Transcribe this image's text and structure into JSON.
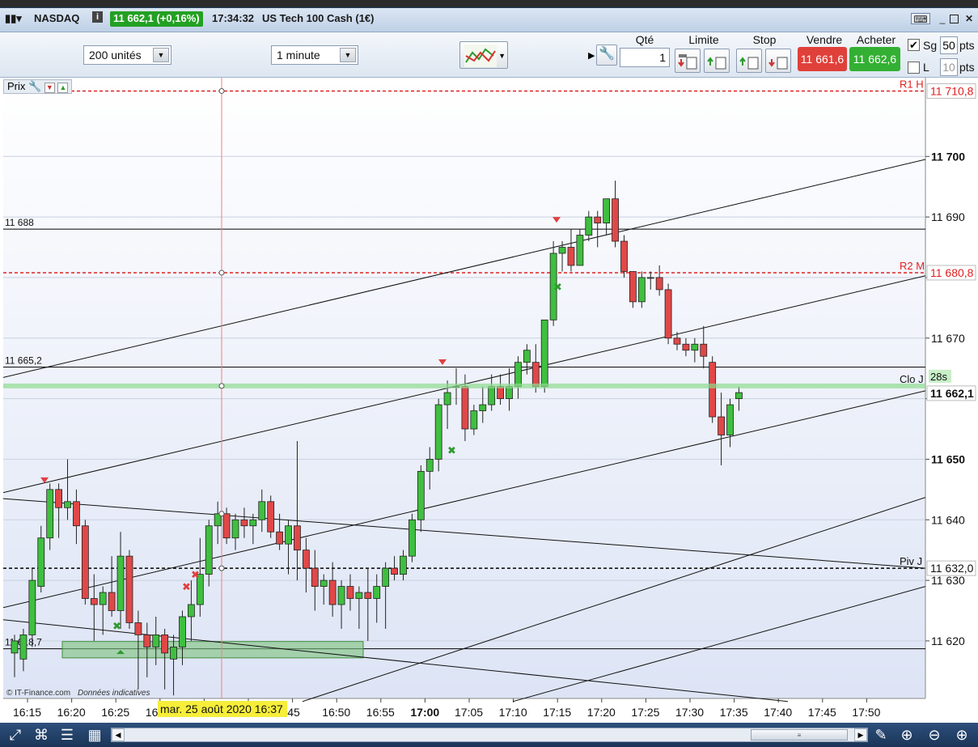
{
  "titlebar": {
    "instrument": "NASDAQ",
    "info_icon": "i",
    "price_change": "11 662,1 (+0,16%)",
    "time": "17:34:32",
    "instrument_full": "US Tech 100 Cash (1€)"
  },
  "toolbar": {
    "units_select": "200 unités",
    "timeframe_select": "1 minute",
    "qty_label": "Qté",
    "qty_value": "1",
    "limit_label": "Limite",
    "stop_label": "Stop",
    "sell_label": "Vendre",
    "buy_label": "Acheter",
    "sell_price": "11 661,6",
    "buy_price": "11 662,6",
    "sg_label": "Sg",
    "sg_value": "50",
    "sg_checked": true,
    "l_label": "L",
    "l_value": "10",
    "pts_label": "pts"
  },
  "chart_header": {
    "prix_label": "Prix"
  },
  "chart_data": {
    "type": "candlestick",
    "y_range": [
      11610.5,
      11713
    ],
    "y_ticks": [
      11700,
      11690,
      11680,
      11670,
      11660,
      11650,
      11640,
      11630,
      11620
    ],
    "y_tick_labels": [
      "11 700",
      "11 690",
      "",
      "11 670",
      "",
      "11 650",
      "11 640",
      "11 630",
      "11 620"
    ],
    "x_ticks": [
      "16:15",
      "16:20",
      "16:25",
      "16:30",
      "16:35",
      "16:40",
      "16:45",
      "16:50",
      "16:55",
      "17:00",
      "17:05",
      "17:10",
      "17:15",
      "17:20",
      "17:25",
      "17:30",
      "17:35",
      "17:40",
      "17:45",
      "17:50"
    ],
    "x_tick_labels_visible": [
      "16:15",
      "16:20",
      "16:25",
      "16",
      "",
      "",
      "6:45",
      "16:50",
      "16:55",
      "17:00",
      "17:05",
      "17:10",
      "17:15",
      "17:20",
      "17:25",
      "17:30",
      "17:35",
      "17:40",
      "17:45",
      "17:50"
    ],
    "bold_tick": "17:00",
    "candles": [
      {
        "o": 11618,
        "h": 11621,
        "l": 11614,
        "c": 11620
      },
      {
        "o": 11617,
        "h": 11622,
        "l": 11615,
        "c": 11621
      },
      {
        "o": 11621,
        "h": 11632,
        "l": 11619,
        "c": 11630
      },
      {
        "o": 11629,
        "h": 11639,
        "l": 11628,
        "c": 11637
      },
      {
        "o": 11637,
        "h": 11646,
        "l": 11635,
        "c": 11645
      },
      {
        "o": 11645,
        "h": 11646,
        "l": 11637,
        "c": 11642
      },
      {
        "o": 11642,
        "h": 11650,
        "l": 11640,
        "c": 11643
      },
      {
        "o": 11643,
        "h": 11645,
        "l": 11636,
        "c": 11639
      },
      {
        "o": 11639,
        "h": 11640,
        "l": 11626,
        "c": 11627
      },
      {
        "o": 11627,
        "h": 11631,
        "l": 11620,
        "c": 11626
      },
      {
        "o": 11626,
        "h": 11629,
        "l": 11621,
        "c": 11628
      },
      {
        "o": 11628,
        "h": 11634,
        "l": 11624,
        "c": 11625
      },
      {
        "o": 11625,
        "h": 11638,
        "l": 11622,
        "c": 11634
      },
      {
        "o": 11634,
        "h": 11635,
        "l": 11622,
        "c": 11623
      },
      {
        "o": 11623,
        "h": 11625,
        "l": 11612,
        "c": 11621
      },
      {
        "o": 11621,
        "h": 11623,
        "l": 11614,
        "c": 11619
      },
      {
        "o": 11619,
        "h": 11624,
        "l": 11616,
        "c": 11621
      },
      {
        "o": 11621,
        "h": 11622,
        "l": 11612,
        "c": 11618
      },
      {
        "o": 11617,
        "h": 11621,
        "l": 11611,
        "c": 11619
      },
      {
        "o": 11619,
        "h": 11625,
        "l": 11616,
        "c": 11624
      },
      {
        "o": 11624,
        "h": 11630,
        "l": 11620,
        "c": 11626
      },
      {
        "o": 11626,
        "h": 11637,
        "l": 11624,
        "c": 11631
      },
      {
        "o": 11631,
        "h": 11640,
        "l": 11629,
        "c": 11639
      },
      {
        "o": 11639,
        "h": 11643,
        "l": 11636,
        "c": 11641
      },
      {
        "o": 11641,
        "h": 11642,
        "l": 11636,
        "c": 11637
      },
      {
        "o": 11637,
        "h": 11641,
        "l": 11635,
        "c": 11640
      },
      {
        "o": 11640,
        "h": 11642,
        "l": 11637,
        "c": 11639
      },
      {
        "o": 11639,
        "h": 11641,
        "l": 11636,
        "c": 11640
      },
      {
        "o": 11640,
        "h": 11645,
        "l": 11638,
        "c": 11643
      },
      {
        "o": 11643,
        "h": 11644,
        "l": 11637,
        "c": 11638
      },
      {
        "o": 11638,
        "h": 11641,
        "l": 11635,
        "c": 11636
      },
      {
        "o": 11636,
        "h": 11640,
        "l": 11631,
        "c": 11639
      },
      {
        "o": 11639,
        "h": 11653,
        "l": 11630,
        "c": 11635
      },
      {
        "o": 11635,
        "h": 11637,
        "l": 11628,
        "c": 11632
      },
      {
        "o": 11632,
        "h": 11635,
        "l": 11625,
        "c": 11629
      },
      {
        "o": 11629,
        "h": 11631,
        "l": 11626,
        "c": 11630
      },
      {
        "o": 11630,
        "h": 11633,
        "l": 11624,
        "c": 11626
      },
      {
        "o": 11626,
        "h": 11630,
        "l": 11622,
        "c": 11629
      },
      {
        "o": 11629,
        "h": 11631,
        "l": 11625,
        "c": 11627
      },
      {
        "o": 11627,
        "h": 11629,
        "l": 11622,
        "c": 11628
      },
      {
        "o": 11628,
        "h": 11632,
        "l": 11620,
        "c": 11627
      },
      {
        "o": 11627,
        "h": 11631,
        "l": 11623,
        "c": 11629
      },
      {
        "o": 11629,
        "h": 11633,
        "l": 11622,
        "c": 11632
      },
      {
        "o": 11632,
        "h": 11634,
        "l": 11630,
        "c": 11631
      },
      {
        "o": 11631,
        "h": 11635,
        "l": 11630,
        "c": 11634
      },
      {
        "o": 11634,
        "h": 11641,
        "l": 11633,
        "c": 11640
      },
      {
        "o": 11640,
        "h": 11649,
        "l": 11638,
        "c": 11648
      },
      {
        "o": 11648,
        "h": 11652,
        "l": 11645,
        "c": 11650
      },
      {
        "o": 11650,
        "h": 11660,
        "l": 11648,
        "c": 11659
      },
      {
        "o": 11659,
        "h": 11663,
        "l": 11655,
        "c": 11661
      },
      {
        "o": 11662,
        "h": 11665,
        "l": 11659,
        "c": 11662
      },
      {
        "o": 11662,
        "h": 11664,
        "l": 11653,
        "c": 11655
      },
      {
        "o": 11655,
        "h": 11659,
        "l": 11654,
        "c": 11658
      },
      {
        "o": 11658,
        "h": 11662,
        "l": 11656,
        "c": 11659
      },
      {
        "o": 11659,
        "h": 11664,
        "l": 11658,
        "c": 11662
      },
      {
        "o": 11662,
        "h": 11664,
        "l": 11659,
        "c": 11660
      },
      {
        "o": 11660,
        "h": 11665,
        "l": 11658,
        "c": 11662
      },
      {
        "o": 11662,
        "h": 11667,
        "l": 11660,
        "c": 11666
      },
      {
        "o": 11666,
        "h": 11669,
        "l": 11664,
        "c": 11668
      },
      {
        "o": 11666,
        "h": 11669,
        "l": 11661,
        "c": 11662
      },
      {
        "o": 11662,
        "h": 11673,
        "l": 11661,
        "c": 11673
      },
      {
        "o": 11673,
        "h": 11686,
        "l": 11672,
        "c": 11684
      },
      {
        "o": 11684,
        "h": 11686,
        "l": 11681,
        "c": 11685
      },
      {
        "o": 11685,
        "h": 11688,
        "l": 11681,
        "c": 11682
      },
      {
        "o": 11682,
        "h": 11688,
        "l": 11682,
        "c": 11687
      },
      {
        "o": 11687,
        "h": 11691,
        "l": 11686,
        "c": 11690
      },
      {
        "o": 11690,
        "h": 11691,
        "l": 11685,
        "c": 11689
      },
      {
        "o": 11689,
        "h": 11693,
        "l": 11687,
        "c": 11693
      },
      {
        "o": 11693,
        "h": 11696,
        "l": 11685,
        "c": 11686
      },
      {
        "o": 11686,
        "h": 11687,
        "l": 11680,
        "c": 11681
      },
      {
        "o": 11681,
        "h": 11681,
        "l": 11675,
        "c": 11676
      },
      {
        "o": 11676,
        "h": 11681,
        "l": 11675,
        "c": 11680
      },
      {
        "o": 11680,
        "h": 11681,
        "l": 11678,
        "c": 11680
      },
      {
        "o": 11680,
        "h": 11682,
        "l": 11677,
        "c": 11678
      },
      {
        "o": 11678,
        "h": 11679,
        "l": 11669,
        "c": 11670
      },
      {
        "o": 11670,
        "h": 11671,
        "l": 11668,
        "c": 11669
      },
      {
        "o": 11669,
        "h": 11670,
        "l": 11667,
        "c": 11668
      },
      {
        "o": 11668,
        "h": 11670,
        "l": 11666,
        "c": 11669
      },
      {
        "o": 11669,
        "h": 11672,
        "l": 11665,
        "c": 11667
      },
      {
        "o": 11666,
        "h": 11667,
        "l": 11656,
        "c": 11657
      },
      {
        "o": 11657,
        "h": 11661,
        "l": 11649,
        "c": 11654
      },
      {
        "o": 11654,
        "h": 11660,
        "l": 11652,
        "c": 11659
      },
      {
        "o": 11660,
        "h": 11662,
        "l": 11658,
        "c": 11661
      }
    ],
    "horizontal_lines": [
      {
        "value": 11688,
        "label_left": "11 688",
        "style": "solid",
        "color": "#000000"
      },
      {
        "value": 11665.2,
        "label_left": "11 665,2",
        "style": "solid",
        "color": "#000000"
      },
      {
        "value": 11618.7,
        "label_left": "11 618,7",
        "style": "solid",
        "color": "#000000"
      },
      {
        "value": 11710.8,
        "label_right": "R1 H",
        "axis_label": "11 710,8",
        "style": "dashed",
        "color": "#e02020"
      },
      {
        "value": 11680.8,
        "label_right": "R2 M",
        "axis_label": "11 680,8",
        "style": "dashed",
        "color": "#e02020"
      },
      {
        "value": 11632.0,
        "label_right": "Piv J",
        "axis_label": "11 632,0",
        "style": "dashed",
        "color": "#000000"
      }
    ],
    "current_price": {
      "value": 11662.1,
      "axis_label": "11 662,1",
      "label_right": "Clo J",
      "countdown": "28s"
    },
    "trendlines": [
      {
        "x1": 0,
        "y1": 11663.5,
        "x2": 1140,
        "y2": 11699.5
      },
      {
        "x1": 0,
        "y1": 11644.5,
        "x2": 1140,
        "y2": 11680.3
      },
      {
        "x1": 0,
        "y1": 11625.5,
        "x2": 1140,
        "y2": 11661.3
      },
      {
        "x1": 370,
        "y1": 11610,
        "x2": 1140,
        "y2": 11643.7
      },
      {
        "x1": 630,
        "y1": 11610,
        "x2": 1140,
        "y2": 11629
      },
      {
        "x1": 0,
        "y1": 11643.5,
        "x2": 1140,
        "y2": 11632
      },
      {
        "x1": 0,
        "y1": 11623.5,
        "x2": 970,
        "y2": 11610
      }
    ],
    "crosshair_date_label": "mar. 25 août 2020 16:37",
    "watermark": "© IT-Finance.com",
    "watermark2": "Données indicatives"
  },
  "bottombar": {
    "icons": [
      "share-icon",
      "magnet-icon",
      "list-icon",
      "compare-icon"
    ],
    "right_icons": [
      "draw-icon",
      "zoom-fit-icon",
      "zoom-out-icon",
      "zoom-in-icon"
    ]
  }
}
